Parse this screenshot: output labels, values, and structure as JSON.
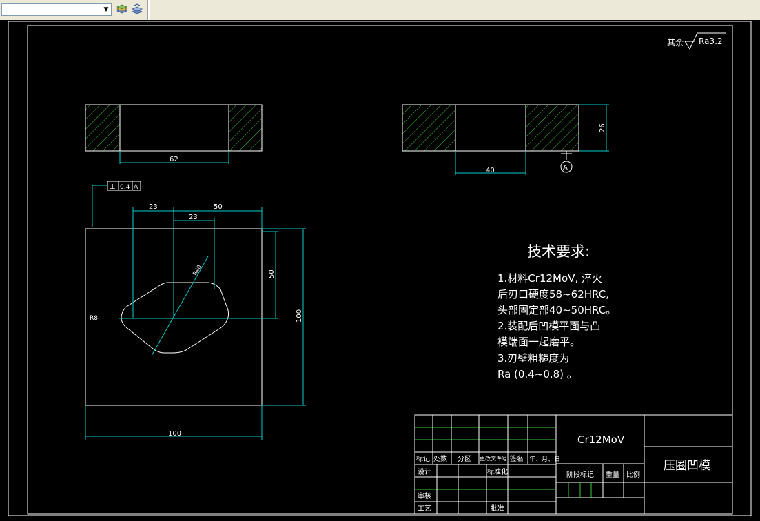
{
  "toolbar": {
    "layer_value": "",
    "icons": [
      "layer-states-icon",
      "layer-previous-icon"
    ]
  },
  "drawing": {
    "roughness_prefix": "其余",
    "roughness_value": "Ra3.2",
    "dims": {
      "top_left_width": "62",
      "top_right_hole": "40",
      "top_right_height": "26",
      "datum": "A",
      "tol_symbol": "⊥",
      "tol_value": "0.4",
      "tol_datum": "A",
      "dim_23_outer": "23",
      "dim_50_top": "50",
      "dim_23_inner": "23",
      "dim_diag": "R40",
      "dim_radius": "R8",
      "dim_50_right": "50",
      "dim_100_right": "100",
      "dim_100_bottom": "100"
    },
    "tech_title": "技术要求:",
    "tech_lines": [
      "1.材料Cr12MoV, 淬火",
      "后刃口硬度58~62HRC,",
      "头部固定部40~50HRC。",
      "2.装配后凹模平面与凸",
      "模端面一起磨平。",
      "3.刃壁粗糙度为",
      "Ra (0.4~0.8) 。"
    ]
  },
  "title_block": {
    "material": "Cr12MoV",
    "part_name": "压圈凹模",
    "headers": [
      "标记",
      "处数",
      "分区",
      "更改文件号",
      "签名",
      "年、月、日"
    ],
    "design": "设计",
    "standard": "标准化",
    "stage_mark": "阶段标记",
    "weight": "重量",
    "scale": "比例",
    "review": "审核",
    "process": "工艺",
    "approve": "批准"
  }
}
